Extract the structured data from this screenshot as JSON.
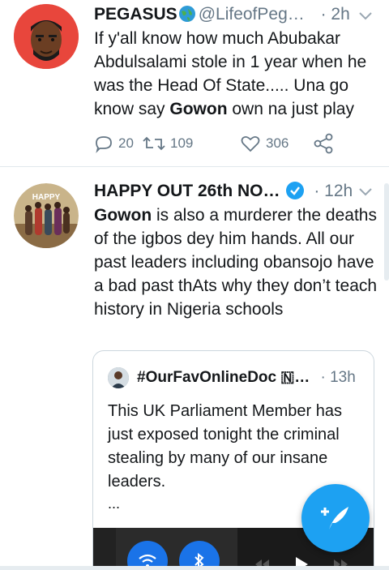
{
  "tweet1": {
    "name": "PEGASUS",
    "handle": "@LifeofPeg…",
    "time": "· 2h",
    "text_a": "If y'all know how much Abubakar Abdulsalami stole in 1 year when he was the Head Of State..... Una go know say ",
    "text_bold": "Gowon",
    "text_b": " own na just play",
    "replies": "20",
    "retweets": "109",
    "likes": "306"
  },
  "tweet2": {
    "name": "HAPPY OUT 26th NO…",
    "time": "· 12h",
    "avatar_label": "HAPPY",
    "text_bold": "Gowon",
    "text_rest": " is also a murderer the deaths of the igbos dey him hands. All our past leaders including obansojo have a bad past thAts why they don’t teach history in Nigeria schools"
  },
  "quote": {
    "name": "#OurFavOnlineDoc 🇳…",
    "time": "· 13h",
    "text": "This UK Parliament Member has just exposed tonight the criminal stealing by many of our insane leaders.",
    "ellipsis": "..."
  },
  "colors": {
    "accent": "#1da1f2",
    "muted": "#657786",
    "avatar_red": "#e8463c"
  }
}
